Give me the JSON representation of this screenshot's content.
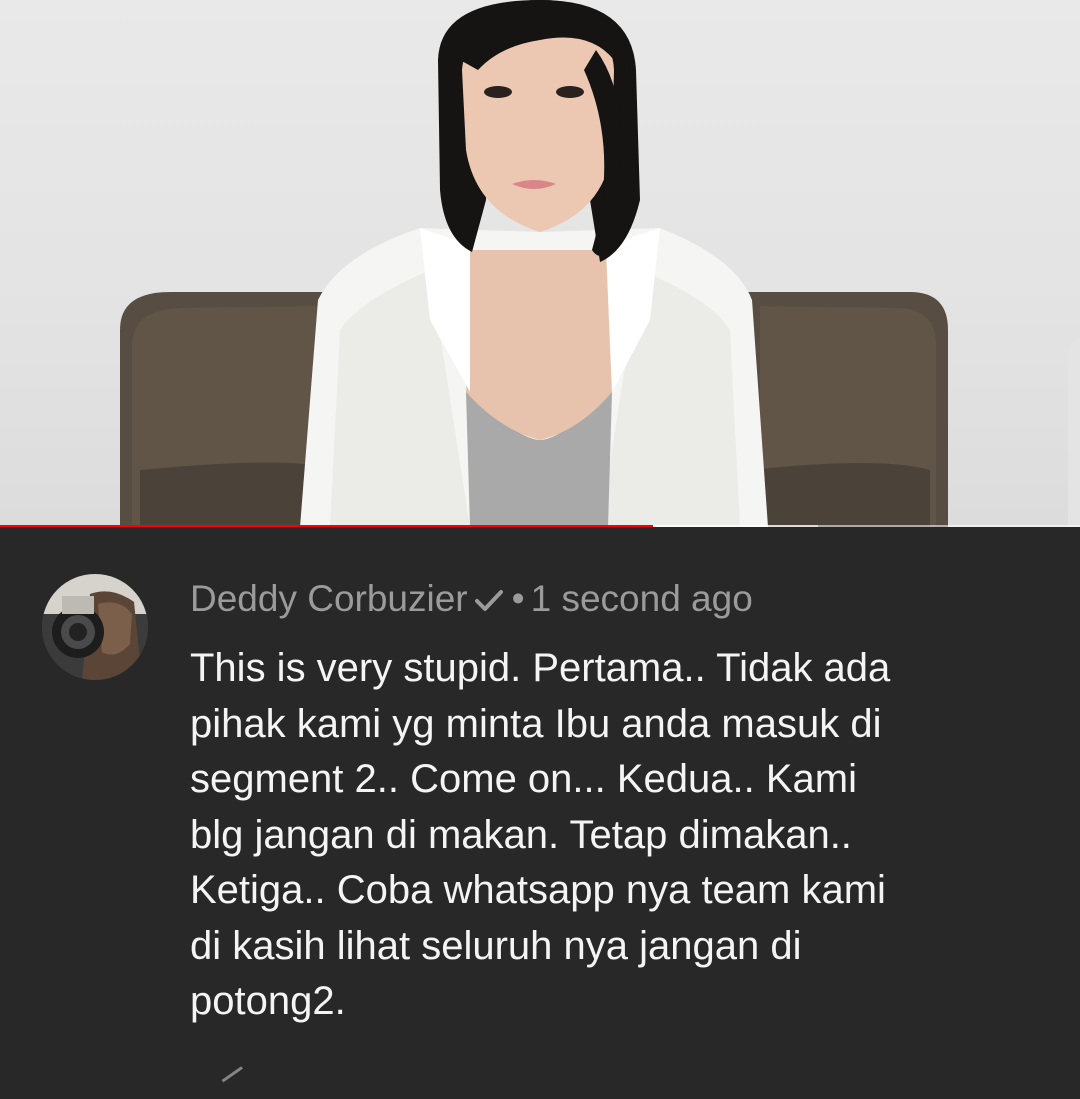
{
  "video": {
    "progress_fraction": 0.605,
    "buffered_fraction": 0.757
  },
  "comment": {
    "author": "Deddy Corbuzier",
    "verified_icon": "check-icon",
    "separator": "•",
    "timestamp": "1 second ago",
    "text_lines": [
      "This is very stupid. Pertama.. Tidak ada",
      "pihak kami yg minta Ibu anda masuk di",
      "segment 2.. Come on... Kedua.. Kami",
      "blg jangan di makan. Tetap dimakan..",
      "Ketiga.. Coba whatsapp nya team kami",
      "di kasih lihat seluruh nya jangan di",
      "potong2."
    ]
  },
  "colors": {
    "background": "#282828",
    "meta_text": "#9b9b9b",
    "body_text": "#f4f4f4",
    "progress": "#ff0000"
  }
}
